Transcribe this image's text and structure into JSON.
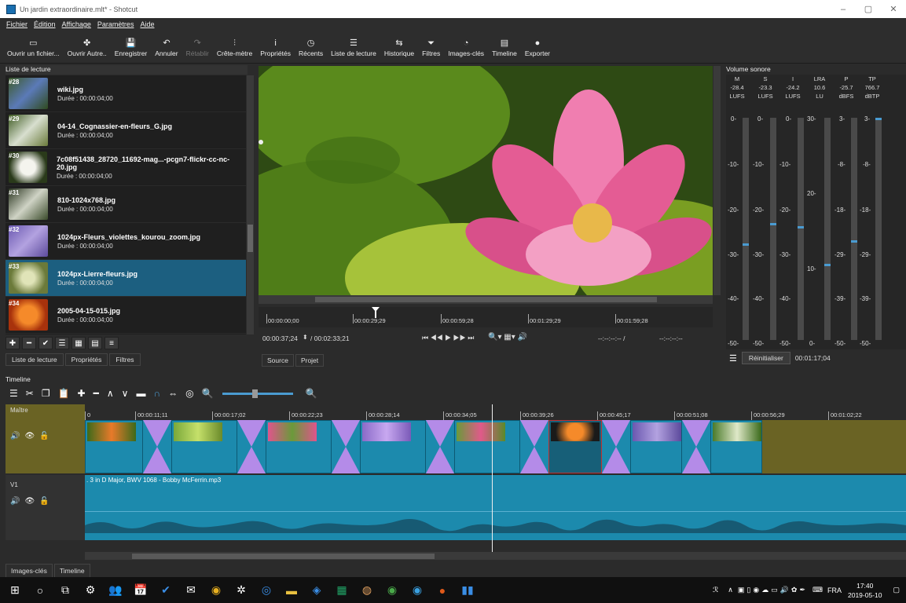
{
  "window": {
    "title": "Un jardin extraordinaire.mlt* - Shotcut",
    "min": "–",
    "max": "▢",
    "close": "✕"
  },
  "menu": [
    "Fichier",
    "Édition",
    "Affichage",
    "Paramètres",
    "Aide"
  ],
  "toolbar": [
    {
      "icon": "▭",
      "label": "Ouvrir un fichier..."
    },
    {
      "icon": "✤",
      "label": "Ouvrir Autre.."
    },
    {
      "icon": "💾",
      "label": "Enregistrer"
    },
    {
      "icon": "↶",
      "label": "Annuler"
    },
    {
      "icon": "↷",
      "label": "Rétablir"
    },
    {
      "icon": "⫶",
      "label": "Crête-mètre"
    },
    {
      "icon": "i",
      "label": "Propriétés"
    },
    {
      "icon": "◷",
      "label": "Récents"
    },
    {
      "icon": "☰",
      "label": "Liste de lecture"
    },
    {
      "icon": "⇆",
      "label": "Historique"
    },
    {
      "icon": "⏷",
      "label": "Filtres"
    },
    {
      "icon": "◔",
      "label": "Images-clés"
    },
    {
      "icon": "▤",
      "label": "Timeline"
    },
    {
      "icon": "●",
      "label": "Exporter"
    }
  ],
  "playlist": {
    "title": "Liste de lecture",
    "items": [
      {
        "num": "#28",
        "name": "wiki.jpg",
        "dur": "Durée : 00:00:04;00",
        "c": "#5b7ab8"
      },
      {
        "num": "#29",
        "name": "04-14_Cognassier-en-fleurs_G.jpg",
        "dur": "Durée : 00:00:04;00",
        "c": "#d8dfcf"
      },
      {
        "num": "#30",
        "name": "7c08f51438_28720_11692-mag...-pcgn7-flickr-cc-nc-20.jpg",
        "dur": "Durée : 00:00:04;00",
        "c": "#e7e9e1"
      },
      {
        "num": "#31",
        "name": "810-1024x768.jpg",
        "dur": "Durée : 00:00:04;00",
        "c": "#cfd3c5"
      },
      {
        "num": "#32",
        "name": "1024px-Fleurs_violettes_kourou_zoom.jpg",
        "dur": "Durée : 00:00:04;00",
        "c": "#8f78c8"
      },
      {
        "num": "#33",
        "name": "1024px-Lierre-fleurs.jpg",
        "dur": "Durée : 00:00:04;00",
        "c": "#a7b86a"
      },
      {
        "num": "#34",
        "name": "2005-04-15-015.jpg",
        "dur": "Durée : 00:00:04;00",
        "c": "#e8621c"
      }
    ],
    "selected": 5,
    "tools": [
      "✚",
      "━",
      "✔",
      "☰",
      "▦",
      "▤",
      "≡"
    ],
    "tabs": [
      "Liste de lecture",
      "Propriétés",
      "Filtres"
    ]
  },
  "viewer": {
    "ticks": [
      "00:00:00;00",
      "00:00:29;29",
      "00:00:59;28",
      "00:01:29;29",
      "00:01:59;28"
    ],
    "position": "00:00:37;24",
    "duration": "/ 00:02:33;21",
    "in": "--:--:--:-- /",
    "out": "--:--:--:--",
    "controls": "⏮ ◀◀ ▶ ▶▶ ⏭",
    "tabs": [
      "Source",
      "Projet"
    ]
  },
  "meter": {
    "title": "Volume sonore",
    "cols": [
      {
        "h": "M",
        "v": "-28.4",
        "u": "LUFS"
      },
      {
        "h": "S",
        "v": "-23.3",
        "u": "LUFS"
      },
      {
        "h": "I",
        "v": "-24.2",
        "u": "LUFS"
      },
      {
        "h": "LRA",
        "v": "10.6",
        "u": "LU"
      },
      {
        "h": "P",
        "v": "-25.7",
        "u": "dBFS"
      },
      {
        "h": "TP",
        "v": "766.7",
        "u": "dBTP"
      }
    ],
    "reset": "Réinitialiser",
    "time": "00:01:17;04"
  },
  "timeline": {
    "title": "Timeline",
    "master": "Maître",
    "v1": "V1",
    "ticks": [
      "0",
      "00:00:11;11",
      "00:00:17;02",
      "00:00:22;23",
      "00:00:28;14",
      "00:00:34;05",
      "00:00:39;26",
      "00:00:45;17",
      "00:00:51;08",
      "00:00:56;29",
      "00:01:02;22"
    ],
    "audio": ". 3 in D Major, BWV 1068 - Bobby McFerrin.mp3",
    "tabs": [
      "Images-clés",
      "Timeline"
    ]
  },
  "taskbar": {
    "lang": "FRA",
    "time": "17:40",
    "date": "2019-05-10"
  }
}
